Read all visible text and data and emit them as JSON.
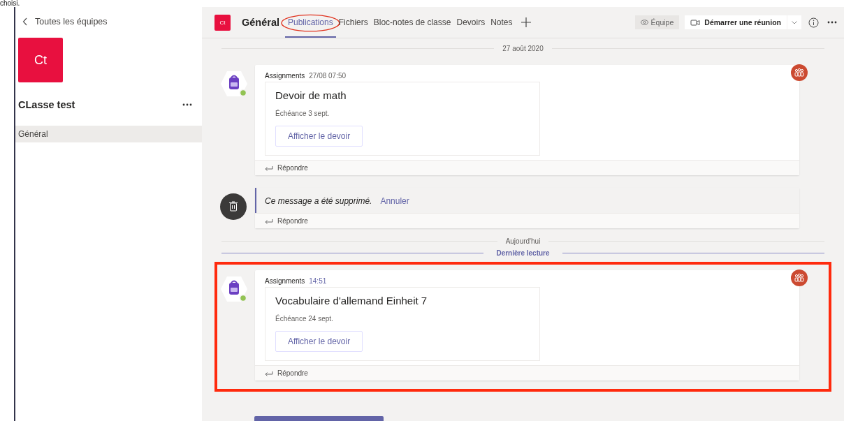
{
  "top_text": "choisi.",
  "sidebar": {
    "back_link": "Toutes les équipes",
    "team_avatar": "Ct",
    "team_name": "CLasse test",
    "channels": [
      {
        "label": "Général",
        "selected": true
      }
    ]
  },
  "header": {
    "avatar": "Ct",
    "channel": "Général",
    "tabs": [
      {
        "label": "Publications",
        "selected": true,
        "highlighted": true
      },
      {
        "label": "Fichiers",
        "selected": false,
        "highlighted": false
      },
      {
        "label": "Bloc-notes de classe",
        "selected": false,
        "highlighted": false
      },
      {
        "label": "Devoirs",
        "selected": false,
        "highlighted": false
      },
      {
        "label": "Notes",
        "selected": false,
        "highlighted": false
      }
    ],
    "team_button": "Équipe",
    "meeting_button": "Démarrer une réunion"
  },
  "feed": [
    {
      "kind": "date",
      "label": "27 août 2020"
    },
    {
      "kind": "assignment",
      "sender": "Assignments",
      "time": "27/08 07:50",
      "new": false,
      "highlighted": false,
      "title": "Devoir de math",
      "due": "Échéance 3 sept.",
      "button": "Afficher le devoir",
      "reply": "Répondre"
    },
    {
      "kind": "deleted",
      "text": "Ce message a été supprimé.",
      "action": "Annuler",
      "reply": "Répondre"
    },
    {
      "kind": "date",
      "label": "Aujourd'hui"
    },
    {
      "kind": "last_read",
      "label": "Dernière lecture"
    },
    {
      "kind": "assignment",
      "sender": "Assignments",
      "time": "14:51",
      "new": true,
      "highlighted": true,
      "title": "Vocabulaire d'allemand Einheit 7",
      "due": "Échéance 24 sept.",
      "button": "Afficher le devoir",
      "reply": "Répondre"
    }
  ]
}
